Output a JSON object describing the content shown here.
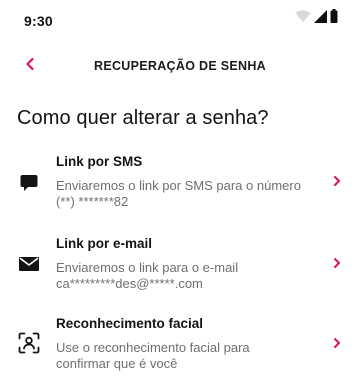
{
  "status_bar": {
    "time": "9:30",
    "icons": [
      "wifi-icon",
      "signal-icon",
      "battery-icon"
    ]
  },
  "header": {
    "back_icon": "chevron-left-icon",
    "title": "RECUPERAÇÃO DE SENHA"
  },
  "heading": "Como quer alterar a senha?",
  "options": [
    {
      "icon": "sms-bubble-icon",
      "title": "Link por SMS",
      "description": "Enviaremos o link por SMS para o número (**) *******82"
    },
    {
      "icon": "envelope-icon",
      "title": "Link por e-mail",
      "description": "Enviaremos o link para o e-mail ca*********des@*****.com"
    },
    {
      "icon": "face-scan-icon",
      "title": "Reconhecimento facial",
      "description": "Use o reconhecimento facial para confirmar que é você"
    }
  ],
  "colors": {
    "accent": "#e0124f",
    "text_primary": "#141414",
    "text_secondary": "#6f6f6f",
    "background": "#ffffff"
  }
}
